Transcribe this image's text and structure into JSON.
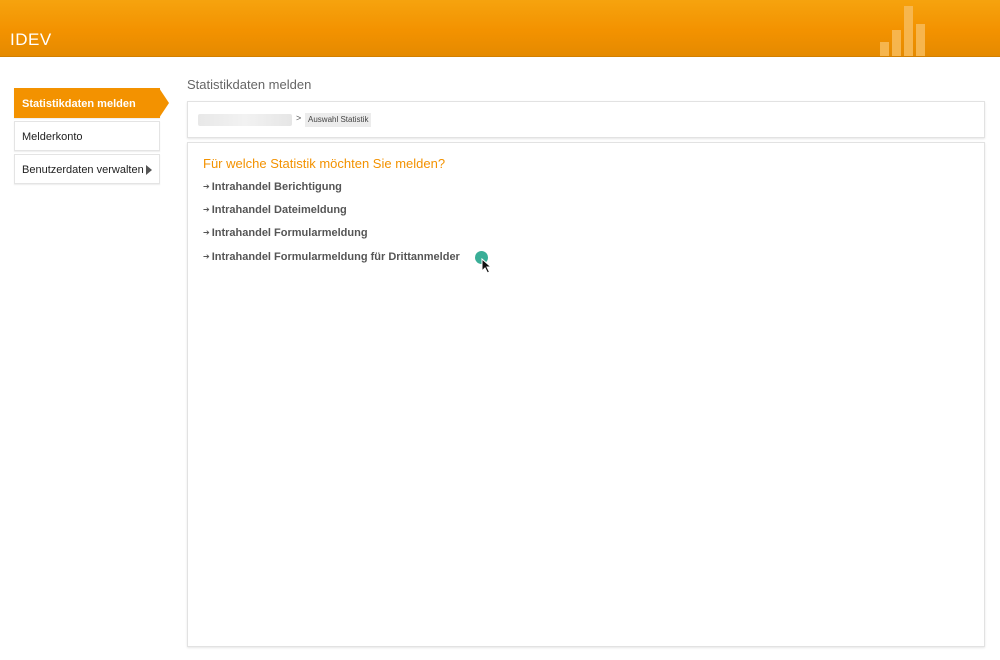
{
  "header": {
    "app_title": "IDEV",
    "brand_color": "#f39200"
  },
  "sidebar": {
    "items": [
      {
        "label": "Statistikdaten melden",
        "active": true
      },
      {
        "label": "Melderkonto",
        "active": false
      },
      {
        "label": "Benutzerdaten verwalten",
        "active": false,
        "icon": "chevron-right-icon"
      }
    ]
  },
  "page": {
    "title": "Statistikdaten melden"
  },
  "breadcrumb": {
    "separator": ">",
    "current": "Auswahl Statistik"
  },
  "main": {
    "question": "Für welche Statistik möchten Sie melden?",
    "links": [
      {
        "label": "Intrahandel Berichtigung"
      },
      {
        "label": "Intrahandel Dateimeldung"
      },
      {
        "label": "Intrahandel Formularmeldung"
      },
      {
        "label": "Intrahandel Formularmeldung für Drittanmelder"
      }
    ],
    "link_arrow": "➔"
  }
}
